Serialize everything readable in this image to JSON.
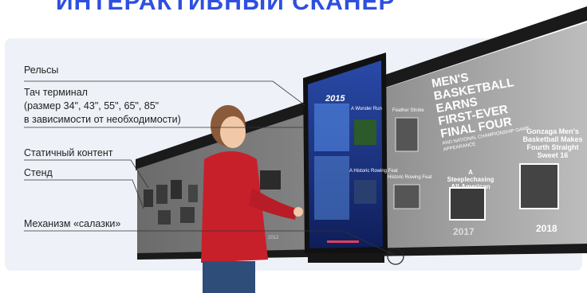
{
  "header": {
    "title": "ИНТЕРАКТИВНЫЙ СКАНЕР"
  },
  "callouts": {
    "rails": "Рельсы",
    "terminal_line1": "Тач терминал",
    "terminal_line2": "(размер 34\", 43\", 55\", 65\", 85\"",
    "terminal_line3": "в зависимости от необходимости)",
    "static": "Статичный контент",
    "stand": "Стенд",
    "slider": "Механизм «салазки»"
  },
  "wall": {
    "headline_lines": [
      "MEN'S BASKETBALL",
      "EARNS",
      "FIRST-EVER",
      "FINAL FOUR"
    ],
    "subline": "AND NATIONAL CHAMPIONSHIP GAME APPEARANCE",
    "steeplechase_caption": "A Steeplechasing All-American",
    "gonzaga_caption": "Gonzaga Men's Basketball Makes Fourth Straight Sweet 16",
    "year_2017": "2017",
    "year_2018": "2018",
    "year_2012": "2012",
    "feather_stroke": "Feather Stroke",
    "rowing_feat": "Historic Rowing Feat"
  },
  "screen": {
    "year": "2015",
    "card1": "A Wonder Run",
    "card2": "A Historic Rowing Feat"
  },
  "colors": {
    "accent": "#2f4fe0",
    "hoodie": "#c8202a",
    "screen": "#1e3a8a"
  }
}
